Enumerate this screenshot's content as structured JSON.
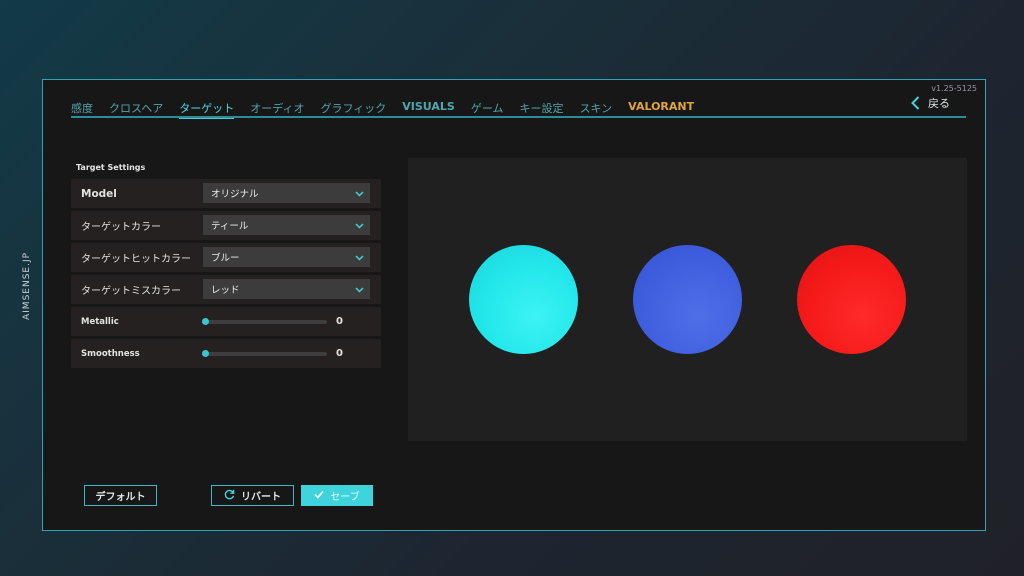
{
  "side_label": "AIMSENSE.JP",
  "version": "v1.25-5125",
  "tabs": [
    {
      "label": "感度"
    },
    {
      "label": "クロスヘア"
    },
    {
      "label": "ターゲット"
    },
    {
      "label": "オーディオ"
    },
    {
      "label": "グラフィック"
    },
    {
      "label": "VISUALS"
    },
    {
      "label": "ゲーム"
    },
    {
      "label": "キー設定"
    },
    {
      "label": "スキン"
    },
    {
      "label": "VALORANT"
    }
  ],
  "active_tab": "ターゲット",
  "back": {
    "label": "戻る",
    "icon": "chevron-left-icon"
  },
  "section_title": "Target Settings",
  "settings": [
    {
      "label": "Model",
      "value": "オリジナル"
    },
    {
      "label": "ターゲットカラー",
      "value": "ティール"
    },
    {
      "label": "ターゲットヒットカラー",
      "value": "ブルー"
    },
    {
      "label": "ターゲットミスカラー",
      "value": "レッド"
    }
  ],
  "sliders": [
    {
      "label": "Metallic",
      "value": "0",
      "fraction": 0
    },
    {
      "label": "Smoothness",
      "value": "0",
      "fraction": 0
    }
  ],
  "preview": {
    "colors": {
      "teal": "#22e6ea",
      "blue": "#3f5fdf",
      "red": "#f51a1a"
    }
  },
  "buttons": {
    "default": "デフォルト",
    "revert": "リバート",
    "save": "セーブ"
  },
  "colors": {
    "accent": "#3fd3dc",
    "valorant": "#e0a53a",
    "panel_border": "#2fa4b3"
  }
}
